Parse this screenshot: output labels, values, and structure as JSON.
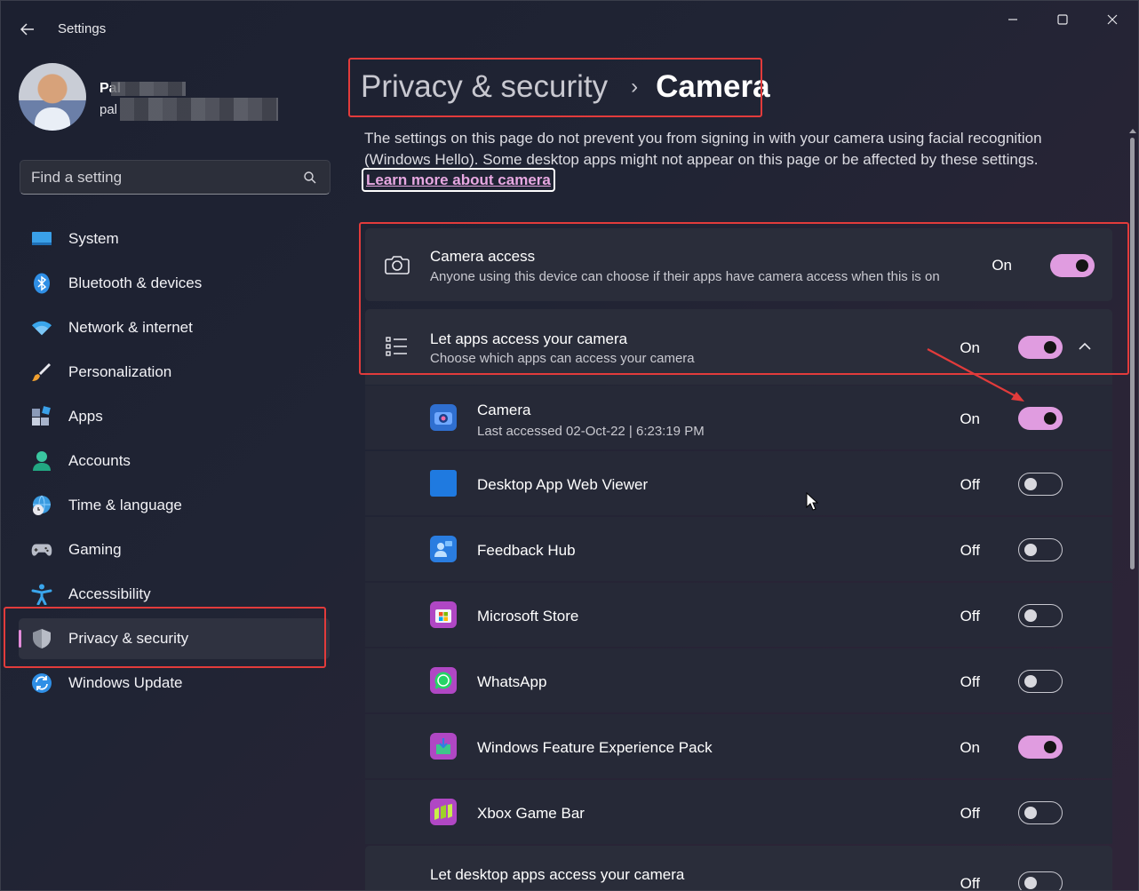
{
  "window": {
    "title": "Settings",
    "controls": [
      "minimize",
      "maximize",
      "close"
    ]
  },
  "profile": {
    "name": "Pal",
    "email": "pal"
  },
  "search": {
    "placeholder": "Find a setting",
    "icon": "search-icon"
  },
  "sidebar": {
    "items": [
      {
        "label": "System",
        "icon": "system-icon",
        "active": false
      },
      {
        "label": "Bluetooth & devices",
        "icon": "bluetooth-icon",
        "active": false
      },
      {
        "label": "Network & internet",
        "icon": "wifi-icon",
        "active": false
      },
      {
        "label": "Personalization",
        "icon": "brush-icon",
        "active": false
      },
      {
        "label": "Apps",
        "icon": "apps-icon",
        "active": false
      },
      {
        "label": "Accounts",
        "icon": "accounts-icon",
        "active": false
      },
      {
        "label": "Time & language",
        "icon": "globe-clock-icon",
        "active": false
      },
      {
        "label": "Gaming",
        "icon": "gamepad-icon",
        "active": false
      },
      {
        "label": "Accessibility",
        "icon": "accessibility-icon",
        "active": false
      },
      {
        "label": "Privacy & security",
        "icon": "shield-icon",
        "active": true
      },
      {
        "label": "Windows Update",
        "icon": "update-icon",
        "active": false
      }
    ]
  },
  "breadcrumb": {
    "parent": "Privacy & security",
    "separator": "›",
    "current": "Camera"
  },
  "description": {
    "text": "The settings on this page do not prevent you from signing in with your camera using facial recognition (Windows Hello). Some desktop apps might not appear on this page or be affected by these settings.",
    "link": "Learn more about camera"
  },
  "camera_access": {
    "title": "Camera access",
    "subtitle": "Anyone using this device can choose if their apps have camera access when this is on",
    "state_label": "On",
    "on": true
  },
  "let_apps": {
    "title": "Let apps access your camera",
    "subtitle": "Choose which apps can access your camera",
    "state_label": "On",
    "on": true,
    "expanded": true
  },
  "apps": [
    {
      "name": "Camera",
      "sub": "Last accessed 02-Oct-22  |  6:23:19 PM",
      "state_label": "On",
      "on": true,
      "icon": "camera-app-icon"
    },
    {
      "name": "Desktop App Web Viewer",
      "sub": "",
      "state_label": "Off",
      "on": false,
      "icon": "web-viewer-icon"
    },
    {
      "name": "Feedback Hub",
      "sub": "",
      "state_label": "Off",
      "on": false,
      "icon": "feedback-hub-icon"
    },
    {
      "name": "Microsoft Store",
      "sub": "",
      "state_label": "Off",
      "on": false,
      "icon": "store-icon"
    },
    {
      "name": "WhatsApp",
      "sub": "",
      "state_label": "Off",
      "on": false,
      "icon": "whatsapp-icon"
    },
    {
      "name": "Windows Feature Experience Pack",
      "sub": "",
      "state_label": "On",
      "on": true,
      "icon": "feature-pack-icon"
    },
    {
      "name": "Xbox Game Bar",
      "sub": "",
      "state_label": "Off",
      "on": false,
      "icon": "xbox-game-bar-icon"
    }
  ],
  "desktop_apps": {
    "title": "Let desktop apps access your camera",
    "state_label": "Off",
    "on": false
  },
  "colors": {
    "accent": "#e09ce0",
    "annotation": "#e23b3b",
    "background": "#202434"
  }
}
